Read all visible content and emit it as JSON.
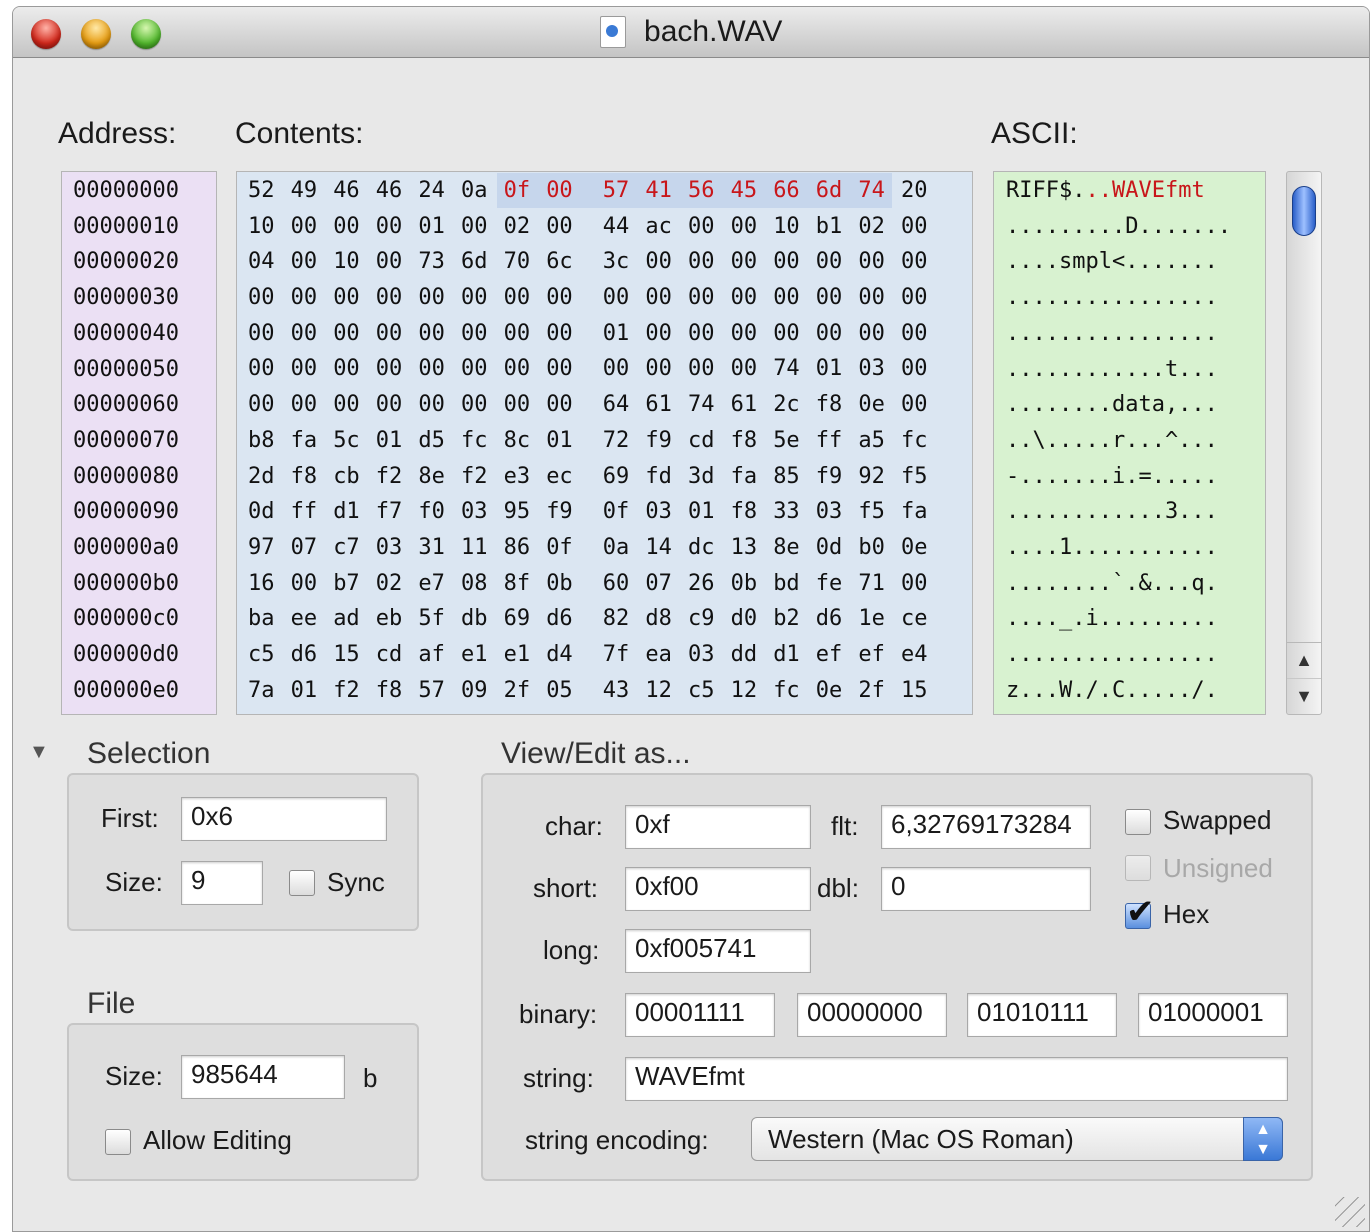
{
  "window": {
    "title": "bach.WAV"
  },
  "labels": {
    "address": "Address:",
    "contents": "Contents:",
    "ascii": "ASCII:"
  },
  "hex_view": {
    "addresses": [
      "00000000",
      "00000010",
      "00000020",
      "00000030",
      "00000040",
      "00000050",
      "00000060",
      "00000070",
      "00000080",
      "00000090",
      "000000a0",
      "000000b0",
      "000000c0",
      "000000d0",
      "000000e0"
    ],
    "rows": [
      [
        "52",
        "49",
        "46",
        "46",
        "24",
        "0a",
        "0f",
        "00",
        "57",
        "41",
        "56",
        "45",
        "66",
        "6d",
        "74",
        "20"
      ],
      [
        "10",
        "00",
        "00",
        "00",
        "01",
        "00",
        "02",
        "00",
        "44",
        "ac",
        "00",
        "00",
        "10",
        "b1",
        "02",
        "00"
      ],
      [
        "04",
        "00",
        "10",
        "00",
        "73",
        "6d",
        "70",
        "6c",
        "3c",
        "00",
        "00",
        "00",
        "00",
        "00",
        "00",
        "00"
      ],
      [
        "00",
        "00",
        "00",
        "00",
        "00",
        "00",
        "00",
        "00",
        "00",
        "00",
        "00",
        "00",
        "00",
        "00",
        "00",
        "00"
      ],
      [
        "00",
        "00",
        "00",
        "00",
        "00",
        "00",
        "00",
        "00",
        "01",
        "00",
        "00",
        "00",
        "00",
        "00",
        "00",
        "00"
      ],
      [
        "00",
        "00",
        "00",
        "00",
        "00",
        "00",
        "00",
        "00",
        "00",
        "00",
        "00",
        "00",
        "74",
        "01",
        "03",
        "00"
      ],
      [
        "00",
        "00",
        "00",
        "00",
        "00",
        "00",
        "00",
        "00",
        "64",
        "61",
        "74",
        "61",
        "2c",
        "f8",
        "0e",
        "00"
      ],
      [
        "b8",
        "fa",
        "5c",
        "01",
        "d5",
        "fc",
        "8c",
        "01",
        "72",
        "f9",
        "cd",
        "f8",
        "5e",
        "ff",
        "a5",
        "fc"
      ],
      [
        "2d",
        "f8",
        "cb",
        "f2",
        "8e",
        "f2",
        "e3",
        "ec",
        "69",
        "fd",
        "3d",
        "fa",
        "85",
        "f9",
        "92",
        "f5"
      ],
      [
        "0d",
        "ff",
        "d1",
        "f7",
        "f0",
        "03",
        "95",
        "f9",
        "0f",
        "03",
        "01",
        "f8",
        "33",
        "03",
        "f5",
        "fa"
      ],
      [
        "97",
        "07",
        "c7",
        "03",
        "31",
        "11",
        "86",
        "0f",
        "0a",
        "14",
        "dc",
        "13",
        "8e",
        "0d",
        "b0",
        "0e"
      ],
      [
        "16",
        "00",
        "b7",
        "02",
        "e7",
        "08",
        "8f",
        "0b",
        "60",
        "07",
        "26",
        "0b",
        "bd",
        "fe",
        "71",
        "00"
      ],
      [
        "ba",
        "ee",
        "ad",
        "eb",
        "5f",
        "db",
        "69",
        "d6",
        "82",
        "d8",
        "c9",
        "d0",
        "b2",
        "d6",
        "1e",
        "ce"
      ],
      [
        "c5",
        "d6",
        "15",
        "cd",
        "af",
        "e1",
        "e1",
        "d4",
        "7f",
        "ea",
        "03",
        "dd",
        "d1",
        "ef",
        "ef",
        "e4"
      ],
      [
        "7a",
        "01",
        "f2",
        "f8",
        "57",
        "09",
        "2f",
        "05",
        "43",
        "12",
        "c5",
        "12",
        "fc",
        "0e",
        "2f",
        "15"
      ]
    ],
    "ascii_first_plain": "RIFF$.",
    "ascii_first_selected": "..WAVEfmt",
    "ascii_rows": [
      "",
      ".........D.......",
      "....smpl<.......",
      "................",
      "................",
      "............t...",
      "........data,...",
      "..\\.....r...^...",
      "-.......i.=.....",
      "............3...",
      "....1...........",
      "........`.&...q.",
      "...._.i.........",
      "................",
      "z...W./.C...../."
    ],
    "selection_color": "#c8161a"
  },
  "selection": {
    "heading": "Selection",
    "first_label": "First:",
    "first_value": "0x6",
    "size_label": "Size:",
    "size_value": "9",
    "sync_label": "Sync",
    "sync_checked": false
  },
  "file": {
    "heading": "File",
    "size_label": "Size:",
    "size_value": "985644",
    "size_unit": "b",
    "allow_editing_label": "Allow Editing",
    "allow_editing_checked": false
  },
  "view_edit": {
    "heading": "View/Edit as...",
    "char_label": "char:",
    "char_value": "0xf",
    "flt_label": "flt:",
    "flt_value": "6,32769173284",
    "short_label": "short:",
    "short_value": "0xf00",
    "dbl_label": "dbl:",
    "dbl_value": "0",
    "long_label": "long:",
    "long_value": "0xf005741",
    "binary_label": "binary:",
    "binary_values": [
      "00001111",
      "00000000",
      "01010111",
      "01000001"
    ],
    "string_label": "string:",
    "string_value": "WAVEfmt",
    "encoding_label": "string encoding:",
    "encoding_value": "Western (Mac OS Roman)",
    "swapped_label": "Swapped",
    "swapped_checked": false,
    "unsigned_label": "Unsigned",
    "unsigned_checked": false,
    "unsigned_enabled": false,
    "hex_label": "Hex",
    "hex_checked": true
  }
}
